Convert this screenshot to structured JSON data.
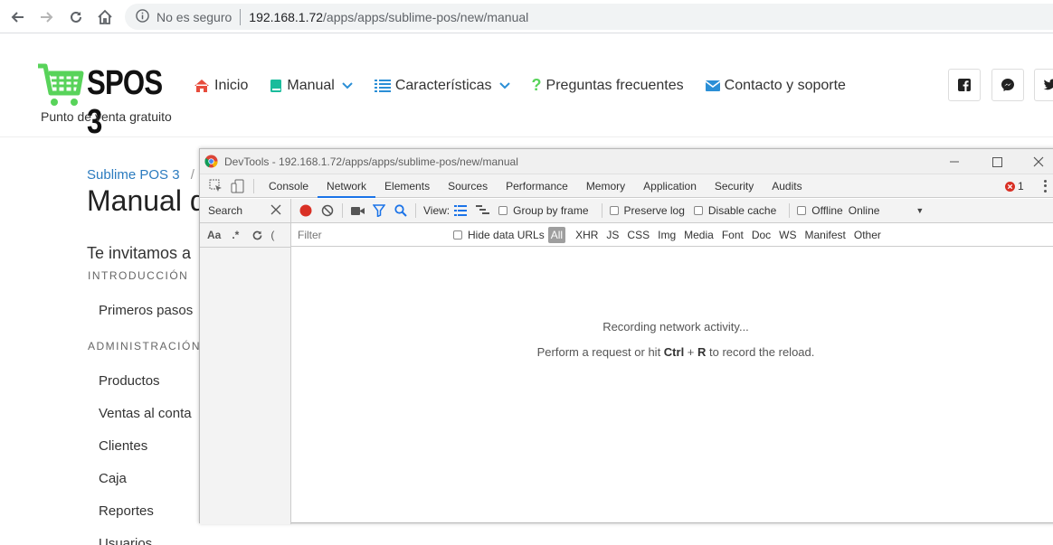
{
  "browser": {
    "security_label": "No es seguro",
    "url_host": "192.168.1.72",
    "url_path": "/apps/apps/sublime-pos/new/manual"
  },
  "site": {
    "logo_text": "SPOS 3",
    "logo_subtitle": "Punto de venta gratuito",
    "nav": [
      {
        "label": "Inicio"
      },
      {
        "label": "Manual"
      },
      {
        "label": "Características"
      },
      {
        "label": "Preguntas frecuentes"
      },
      {
        "label": "Contacto y soporte"
      }
    ],
    "accent_color": "#2b8fd6",
    "logo_color": "#58d35a"
  },
  "page": {
    "breadcrumb": "Sublime POS 3",
    "breadcrumb_sep": "/",
    "title": "Manual d",
    "lead": "Te invitamos a",
    "sections": [
      {
        "label": "INTRODUCCIÓN",
        "items": [
          "Primeros pasos"
        ]
      },
      {
        "label": "ADMINISTRACIÓN",
        "items": [
          "Productos",
          "Ventas al conta",
          "Clientes",
          "Caja",
          "Reportes",
          "Usuarios"
        ]
      }
    ]
  },
  "devtools": {
    "title": "DevTools - 192.168.1.72/apps/apps/sublime-pos/new/manual",
    "tabs": [
      "Console",
      "Network",
      "Elements",
      "Sources",
      "Performance",
      "Memory",
      "Application",
      "Security",
      "Audits"
    ],
    "active_tab": "Network",
    "error_count": "1",
    "search_label": "Search",
    "aa_label": "Aa",
    "regex_label": ".*",
    "view_label": "View:",
    "group_by_frame": "Group by frame",
    "preserve_log": "Preserve log",
    "disable_cache": "Disable cache",
    "offline": "Offline",
    "throttle": "Online",
    "filter_placeholder": "Filter",
    "hide_data_urls": "Hide data URLs",
    "filter_types": [
      "All",
      "XHR",
      "JS",
      "CSS",
      "Img",
      "Media",
      "Font",
      "Doc",
      "WS",
      "Manifest",
      "Other"
    ],
    "empty_line1": "Recording network activity...",
    "empty_line2_pre": "Perform a request or hit ",
    "empty_key1": "Ctrl",
    "empty_plus": " + ",
    "empty_key2": "R",
    "empty_line2_post": " to record the reload."
  }
}
